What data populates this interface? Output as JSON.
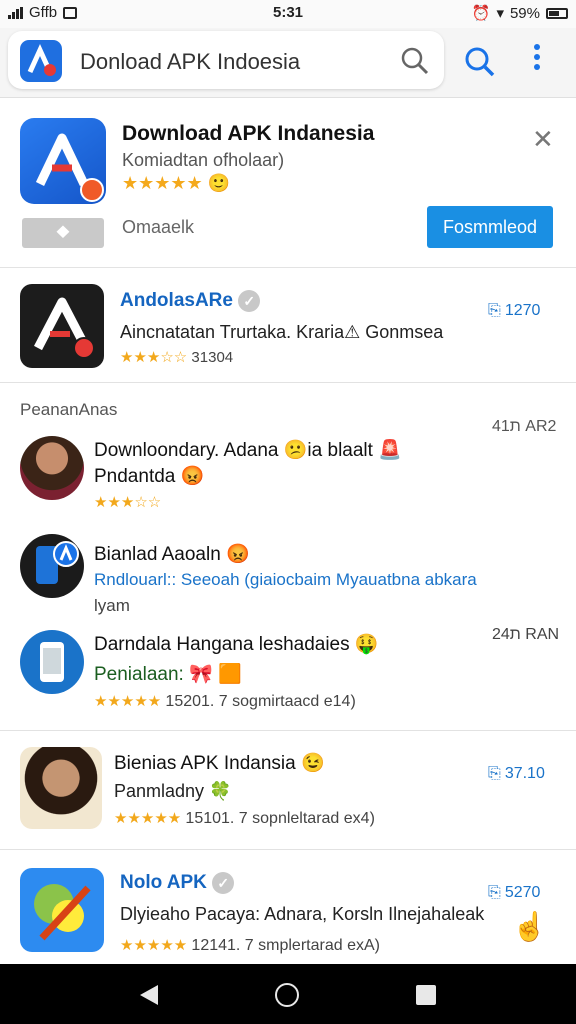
{
  "status_bar": {
    "carrier": "Gffb",
    "time": "5:31",
    "battery": "59%"
  },
  "search": {
    "query": "Donload APK Indoesia"
  },
  "promo": {
    "title": "Download APK Indanesia",
    "subtitle": "Komiadtan ofholaar)",
    "stars": "★★★★★",
    "emoji": "🙂",
    "grey_button": "⯁",
    "grey_label": "Omaaelk",
    "download_button": "Fosmmleod",
    "close": "✕"
  },
  "featured": {
    "name": "AndolasARe",
    "desc": "Aincnatatan Trurtaka. Kraria⚠ Gonmsea",
    "stars": "★★★☆☆",
    "count": "31304",
    "stat": "1270"
  },
  "section": {
    "title": "PeananAnas",
    "side": "41ת AR2"
  },
  "posts": [
    {
      "title": "Downloondary. Adana 😕ia blaalt 🚨",
      "sub": "Pndantda 😡",
      "stars": "★★★☆☆",
      "meta": ""
    },
    {
      "title": "Bianlad Aaoaln 😡",
      "sub": "Rndlouarl:: Seeoah (giaiocbaim Myauatbna abkara",
      "sub2": "lyam",
      "stars": "",
      "meta": ""
    },
    {
      "title": "Darndala Hangana leshadaies 🤑",
      "sub": "Penialaan: 🎀 🟧",
      "stars": "★★★★★",
      "meta": "15201. 7 sogmirtaacd e14)",
      "side": "24ת RAN"
    }
  ],
  "apps": [
    {
      "name": "Bienias APK Indansia 😉",
      "sub": "Panmladny",
      "badge": "🍀",
      "stars": "★★★★★",
      "meta": "15101. 7 sopnleltarad ex4)",
      "stat": "37.10"
    },
    {
      "name": "Nolo APK",
      "sub": "Dlyieaho Pacaya: Adnara, Korsln Ilnejahaleak",
      "stars": "★★★★★",
      "meta": "12141. 7 smplertarad exA)",
      "stat": "5270"
    }
  ],
  "colors": {
    "accent": "#1a8fe3",
    "star": "#f2a81c",
    "link": "#1a73c9"
  }
}
